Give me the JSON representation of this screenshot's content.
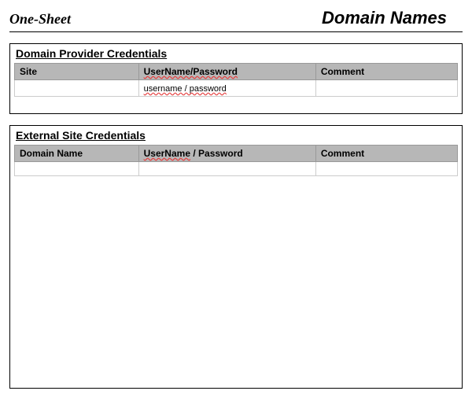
{
  "header": {
    "left": "One-Sheet",
    "right": "Domain Names"
  },
  "providerPanel": {
    "title": "Domain Provider Credentials",
    "headers": {
      "site": "Site",
      "userpw": "UserName/Password",
      "comment": "Comment"
    },
    "row": {
      "site": "",
      "userpw": "username / password",
      "comment": ""
    }
  },
  "externalPanel": {
    "title": "External Site Credentials",
    "headers": {
      "domain": "Domain Name",
      "userpw_a": "UserName",
      "userpw_sep": " / ",
      "userpw_b": "Password",
      "comment": "Comment"
    },
    "row": {
      "domain": "",
      "userpw": "",
      "comment": ""
    }
  }
}
